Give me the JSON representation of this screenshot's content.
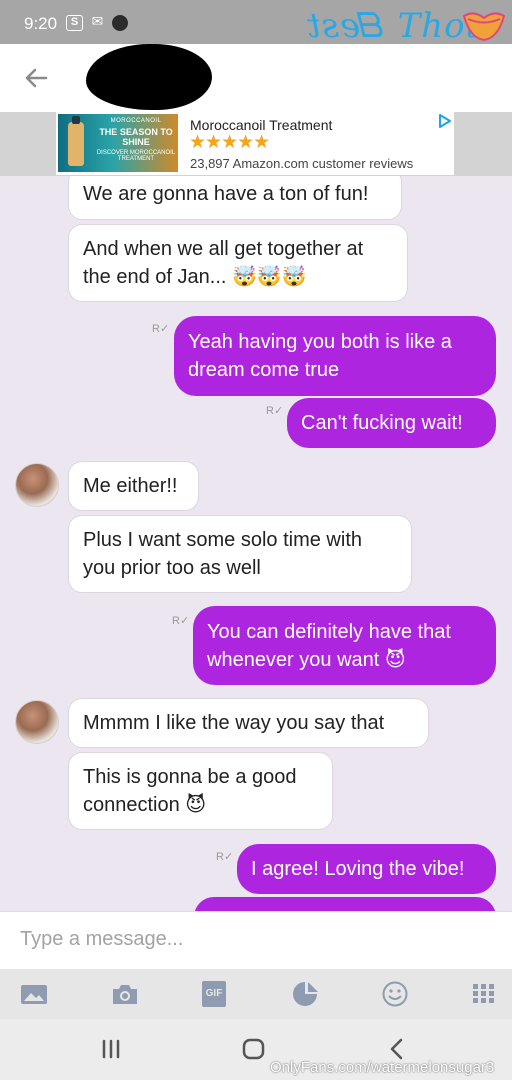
{
  "status_bar": {
    "time": "9:20",
    "icons": [
      "s-icon",
      "gmail-icon",
      "camera-record-icon"
    ]
  },
  "watermark_top": {
    "text_mirrored": "ᗺest",
    "text": "Thot"
  },
  "header": {
    "back_icon": "back-arrow-icon",
    "contact_name_redacted": true
  },
  "ad": {
    "image_line1": "MOROCCANOIL",
    "image_line2": "THE SEASON TO SHINE",
    "image_line3": "DISCOVER MOROCCANOIL TREATMENT",
    "title": "Moroccanoil Treatment",
    "stars": "★★★★★",
    "reviews": "23,897 Amazon.com customer reviews",
    "play_icon": "ad-play-icon"
  },
  "messages": [
    {
      "dir": "in",
      "lines": [
        "We are gonna have a ton of fun!"
      ]
    },
    {
      "dir": "in",
      "lines": [
        "And when we all get together at",
        "the end of Jan... 🤯🤯🤯"
      ]
    },
    {
      "dir": "out",
      "lines": [
        "Yeah having you both is like a",
        "dream come true"
      ]
    },
    {
      "dir": "out",
      "lines": [
        "Can't fucking wait!"
      ]
    },
    {
      "dir": "in",
      "lines": [
        "Me either!!"
      ]
    },
    {
      "dir": "in",
      "lines": [
        "Plus I want some solo time with",
        "you prior too as well"
      ]
    },
    {
      "dir": "out",
      "lines": [
        "You can definitely have that",
        "whenever you want 😈"
      ]
    },
    {
      "dir": "in",
      "lines": [
        "Mmmm I like the way you say that"
      ]
    },
    {
      "dir": "in",
      "lines": [
        "This is gonna be a good",
        "connection 😈"
      ]
    },
    {
      "dir": "out",
      "lines": [
        "I agree! Loving the vibe!"
      ]
    }
  ],
  "receipt_glyph": "R✓",
  "input": {
    "placeholder": "Type a message..."
  },
  "toolbar": {
    "icons": [
      "image-icon",
      "camera-icon",
      "gif-icon",
      "sticker-icon",
      "emoji-icon",
      "apps-grid-icon"
    ],
    "gif_label": "GIF"
  },
  "navbar": {
    "icons": [
      "recent-apps-icon",
      "home-icon",
      "back-icon"
    ]
  },
  "watermark_bottom": "OnlyFans.com/watermelonsugar3",
  "colors": {
    "outgoing": "#ae25e0",
    "background": "#ebe6ef",
    "status_bar": "#a6a6a6"
  }
}
